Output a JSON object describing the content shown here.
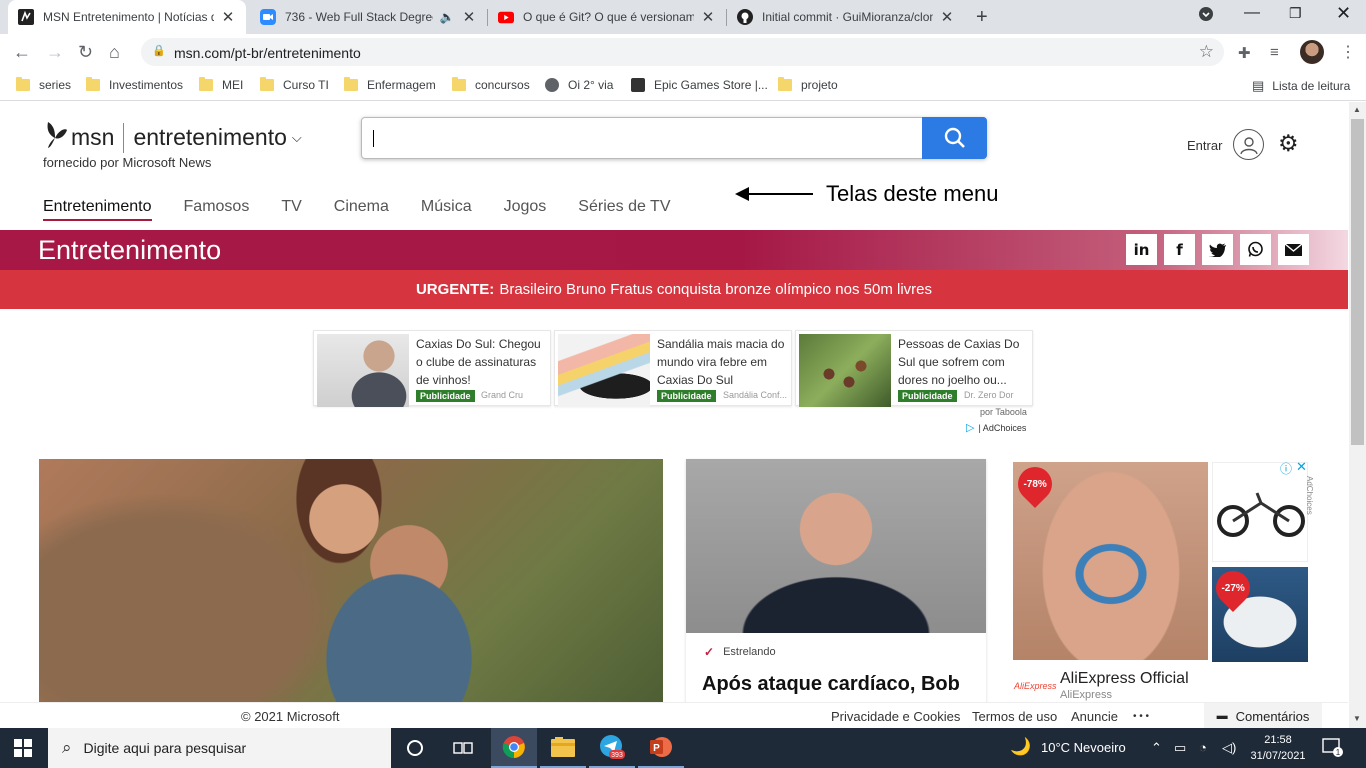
{
  "browser": {
    "tabs": [
      {
        "title": "MSN Entretenimento | Notícias d",
        "active": true,
        "icon": "msn-icon"
      },
      {
        "title": "736 - Web Full Stack Degree",
        "active": false,
        "icon": "zoom-icon"
      },
      {
        "title": "O que é Git? O que é versioname",
        "active": false,
        "icon": "youtube-icon"
      },
      {
        "title": "Initial commit · GuiMioranza/clon",
        "active": false,
        "icon": "github-icon"
      }
    ],
    "url": "msn.com/pt-br/entretenimento",
    "bookmarks": [
      "series",
      "Investimentos",
      "MEI",
      "Curso TI",
      "Enfermagem",
      "concursos",
      "Oi 2° via",
      "Epic Games Store |...",
      "projeto"
    ],
    "reading_list": "Lista de leitura"
  },
  "header": {
    "brand": "msn",
    "section": "entretenimento",
    "powered_by": "fornecido por Microsoft News",
    "signin": "Entrar"
  },
  "menu": [
    "Entretenimento",
    "Famosos",
    "TV",
    "Cinema",
    "Música",
    "Jogos",
    "Séries de TV"
  ],
  "annotation": "Telas deste menu",
  "banner_title": "Entretenimento",
  "share_icons": [
    "linkedin-icon",
    "facebook-icon",
    "twitter-icon",
    "whatsapp-icon",
    "mail-icon"
  ],
  "urgent": {
    "label": "URGENTE:",
    "text": "Brasileiro Bruno Fratus conquista bronze olímpico nos 50m livres"
  },
  "ads": [
    {
      "text": "Caxias Do Sul: Chegou o clube de assinaturas de vinhos!",
      "badge": "Publicidade",
      "source": "Grand Cru"
    },
    {
      "text": "Sandália mais macia do mundo vira febre em Caxias Do Sul",
      "badge": "Publicidade",
      "source": "Sandália Conf..."
    },
    {
      "text": "Pessoas de Caxias Do Sul que sofrem com dores no joelho ou...",
      "badge": "Publicidade",
      "source": "Dr. Zero Dor"
    }
  ],
  "taboola": "por Taboola",
  "adchoices": "| AdChoices",
  "story": {
    "source": "Estrelando",
    "headline": "Após ataque cardíaco, Bob"
  },
  "right_ad": {
    "discount1": "-78%",
    "discount2": "-27%",
    "brand": "AliExpress Official",
    "brand_sub": "AliExpress",
    "logo_text": "AliExpress",
    "vertical_label": "AdChoices"
  },
  "footer": {
    "copyright": "© 2021 Microsoft",
    "privacy": "Privacidade e Cookies",
    "terms": "Termos de uso",
    "advertise": "Anuncie",
    "more": "• • •",
    "comments": "Comentários"
  },
  "taskbar": {
    "search_placeholder": "Digite aqui para pesquisar",
    "telegram_badge": "393",
    "weather": "10°C  Nevoeiro",
    "time": "21:58",
    "date": "31/07/2021",
    "notifications": "1"
  }
}
